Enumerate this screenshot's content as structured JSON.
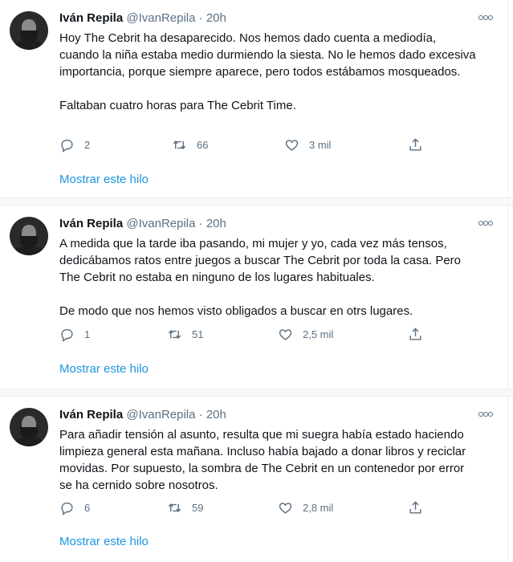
{
  "tweets": [
    {
      "name": "Iván Repila",
      "handle": "@IvanRepila",
      "dot": "·",
      "time": "20h",
      "paragraphs": [
        "Hoy The Cebrit ha desaparecido. Nos hemos dado cuenta a mediodía, cuando la niña estaba medio durmiendo la siesta. No le hemos dado excesiva importancia, porque siempre aparece, pero todos estábamos mosqueados.",
        "Faltaban cuatro horas para The Cebrit Time."
      ],
      "replies": "2",
      "retweets": "66",
      "likes": "3 mil",
      "link": "Mostrar este hilo"
    },
    {
      "name": "Iván Repila",
      "handle": "@IvanRepila",
      "dot": "·",
      "time": "20h",
      "paragraphs": [
        "A medida que la tarde iba pasando, mi mujer y yo, cada vez más tensos, dedicábamos ratos entre juegos a buscar The Cebrit por toda la casa. Pero The Cebrit no estaba en ninguno de los lugares habituales.",
        "De modo que nos hemos visto obligados a buscar en otrs lugares."
      ],
      "replies": "1",
      "retweets": "51",
      "likes": "2,5 mil",
      "link": "Mostrar este hilo"
    },
    {
      "name": "Iván Repila",
      "handle": "@IvanRepila",
      "dot": "·",
      "time": "20h",
      "paragraphs": [
        "Para añadir tensión al asunto, resulta que mi suegra había estado haciendo limpieza general esta mañana. Incluso había bajado a donar libros y reciclar movidas. Por supuesto, la sombra de The Cebrit en un contenedor por error se ha cernido sobre nosotros."
      ],
      "replies": "6",
      "retweets": "59",
      "likes": "2,8 mil",
      "link": "Mostrar este hilo"
    }
  ],
  "icons": {
    "reply": "reply-icon",
    "retweet": "retweet-icon",
    "like": "like-icon",
    "share": "share-icon",
    "more": "more-icon"
  },
  "colors": {
    "link": "#1b95e0",
    "secondary": "#5b7083",
    "separator": "#f7f9fa"
  }
}
